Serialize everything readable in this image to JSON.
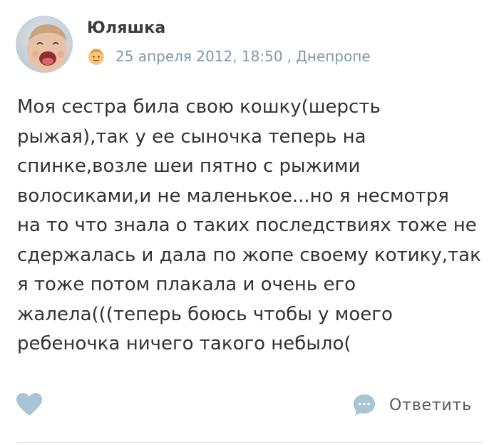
{
  "post": {
    "author": "Юляшка",
    "date": "25 апреля 2012, 18:50",
    "location": ", Днепропе",
    "text_lines": [
      "Моя сестра била свою кошку(шерсть",
      "рыжая),так у ее сыночка теперь на",
      "спинке,возле шеи пятно с рыжими",
      "волосиками,и не маленькое...но я несмотря",
      "на то что знала о таких последствиях тоже не",
      "сдержалась и дала по жопе своему котику,так",
      "я тоже потом плакала и очень его",
      "жалела(((теперь боюсь чтобы у моего",
      "ребеночка ничего такого небыло("
    ]
  },
  "actions": {
    "reply_label": "Ответить"
  },
  "icons": {
    "avatar": "avatar-photo",
    "mood": "smiley-face-icon",
    "like": "heart-icon",
    "reply": "speech-bubble-icon"
  },
  "colors": {
    "meta_text": "#7d98ad",
    "icon_blue": "#a9c4d6",
    "body_text": "#333333"
  }
}
